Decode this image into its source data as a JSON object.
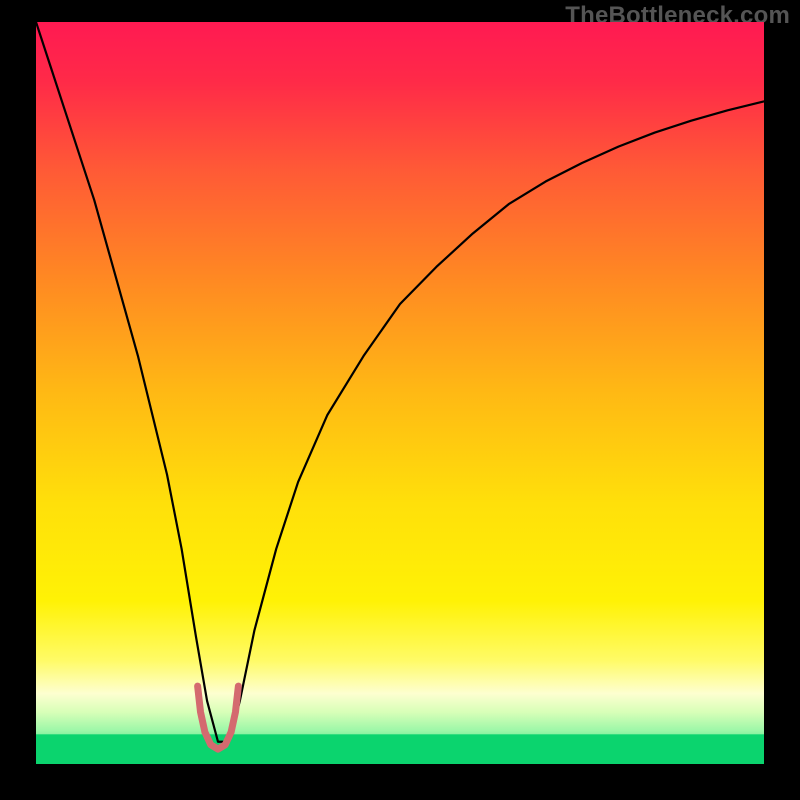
{
  "watermark": "TheBottleneck.com",
  "chart_data": {
    "type": "line",
    "title": "",
    "xlabel": "",
    "ylabel": "",
    "xlim": [
      0,
      100
    ],
    "ylim": [
      0,
      100
    ],
    "background_gradient": {
      "stops": [
        {
          "pos": 0.0,
          "color": "#ff1a52"
        },
        {
          "pos": 0.08,
          "color": "#ff2a48"
        },
        {
          "pos": 0.2,
          "color": "#ff5a36"
        },
        {
          "pos": 0.35,
          "color": "#ff8a22"
        },
        {
          "pos": 0.5,
          "color": "#ffb914"
        },
        {
          "pos": 0.65,
          "color": "#ffe00a"
        },
        {
          "pos": 0.78,
          "color": "#fff205"
        },
        {
          "pos": 0.86,
          "color": "#fffb66"
        },
        {
          "pos": 0.905,
          "color": "#fdffd0"
        },
        {
          "pos": 0.93,
          "color": "#d8ffb8"
        },
        {
          "pos": 0.955,
          "color": "#9cf7a8"
        },
        {
          "pos": 0.975,
          "color": "#4de58c"
        },
        {
          "pos": 1.0,
          "color": "#0bd46e"
        }
      ]
    },
    "series": [
      {
        "name": "bottleneck-curve",
        "stroke": "#000000",
        "stroke_width": 2.2,
        "x": [
          0,
          2,
          4,
          6,
          8,
          10,
          12,
          14,
          16,
          18,
          20,
          22,
          23.5,
          25,
          26.5,
          28,
          30,
          33,
          36,
          40,
          45,
          50,
          55,
          60,
          65,
          70,
          75,
          80,
          85,
          90,
          95,
          100
        ],
        "values": [
          100,
          94,
          88,
          82,
          76,
          69,
          62,
          55,
          47,
          39,
          29,
          17,
          8.5,
          3.0,
          3.0,
          8.5,
          18,
          29,
          38,
          47,
          55,
          62,
          67,
          71.5,
          75.5,
          78.5,
          81,
          83.2,
          85.1,
          86.7,
          88.1,
          89.3
        ]
      },
      {
        "name": "optimal-region-marker",
        "stroke": "#d46a6f",
        "stroke_width": 7,
        "x": [
          22.2,
          22.6,
          23.2,
          24.0,
          25.0,
          26.0,
          26.8,
          27.4,
          27.8
        ],
        "values": [
          10.5,
          7.0,
          4.3,
          2.6,
          2.0,
          2.6,
          4.3,
          7.0,
          10.5
        ]
      }
    ],
    "green_band": {
      "from": 0,
      "to": 4
    },
    "annotations": []
  }
}
